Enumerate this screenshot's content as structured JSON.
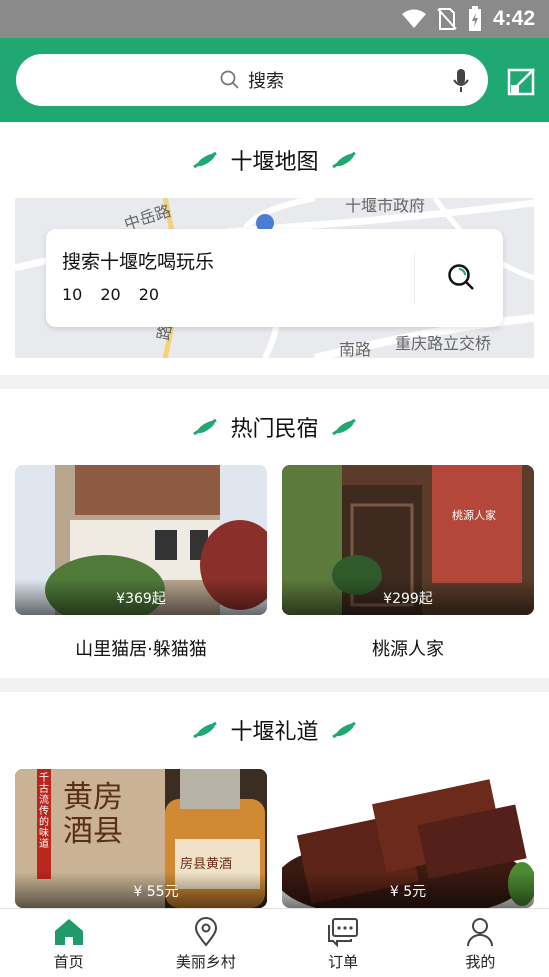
{
  "status_bar": {
    "time": "4:42"
  },
  "header": {
    "search_placeholder": "搜索"
  },
  "map_section": {
    "title": "十堰地图",
    "card_title": "搜索十堰吃喝玩乐",
    "card_numbers": [
      "10",
      "20",
      "20"
    ],
    "labels": [
      "中岳路",
      "十堰市政府",
      "重庆路立交桥",
      "南路",
      "路"
    ]
  },
  "homestay_section": {
    "title": "热门民宿",
    "items": [
      {
        "name": "山里猫居·躲猫猫",
        "price": "¥369起"
      },
      {
        "name": "桃源人家",
        "price": "¥299起"
      }
    ]
  },
  "gift_section": {
    "title": "十堰礼道",
    "items": [
      {
        "price": "¥ 55元",
        "bottle_text": "房县黄酒",
        "poster_text": "黄房 酒县",
        "slogan": "千古流传的味道"
      },
      {
        "price": "¥ 5元"
      }
    ]
  },
  "signboard_text": {
    "name": "桃源人家"
  },
  "tabbar": {
    "tabs": [
      {
        "label": "首页",
        "icon": "home-icon",
        "active": true
      },
      {
        "label": "美丽乡村",
        "icon": "location-pin-icon",
        "active": false
      },
      {
        "label": "订单",
        "icon": "chat-order-icon",
        "active": false
      },
      {
        "label": "我的",
        "icon": "user-icon",
        "active": false
      }
    ]
  },
  "colors": {
    "brand": "#20a873",
    "active_tab": "#1f9a6a"
  }
}
